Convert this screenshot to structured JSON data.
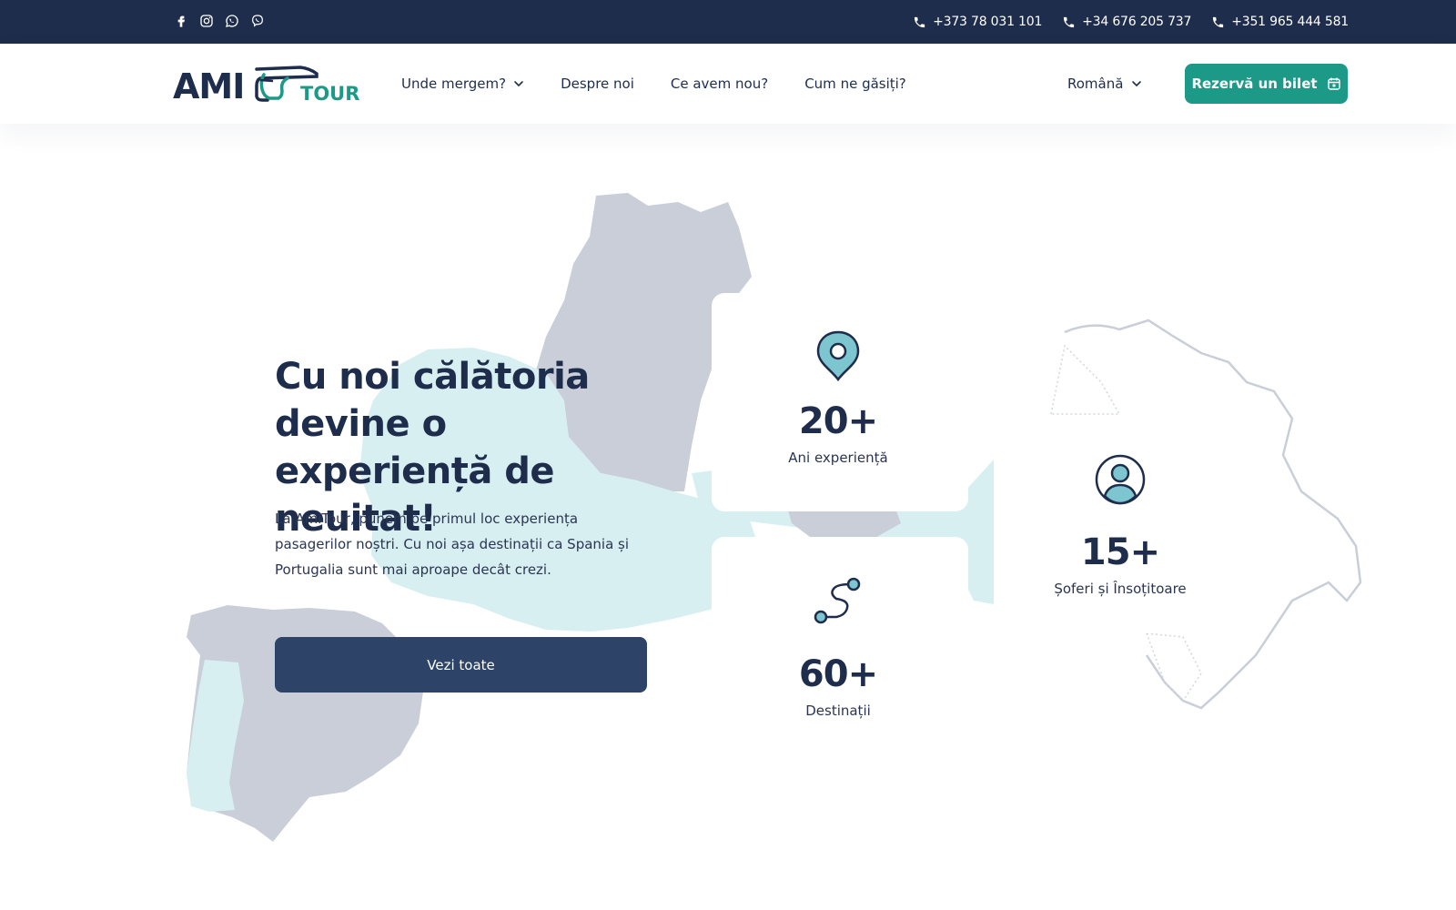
{
  "topbar": {
    "social": [
      {
        "icon": "facebook-icon"
      },
      {
        "icon": "instagram-icon"
      },
      {
        "icon": "whatsapp-icon"
      },
      {
        "icon": "viber-icon"
      }
    ],
    "phones": [
      "+373 78 031 101",
      "+34 676 205 737",
      "+351 965 444 581"
    ]
  },
  "header": {
    "logo": {
      "primary": "AMI",
      "secondary": "TOUR"
    },
    "nav": [
      "Unde mergem?",
      "Despre noi",
      "Ce avem nou?",
      "Cum ne găsiți?"
    ],
    "language": "Română",
    "book_button": "Rezervă un bilet"
  },
  "hero": {
    "title": "Cu noi călătoria devine o experiență de neuitat!",
    "text": "La AmiTour, punem pe primul loc experiența pasagerilor noștri. Cu noi așa destinații ca Spania și Portugalia sunt mai aproape decât crezi.",
    "cta": "Vezi toate"
  },
  "stats": [
    {
      "value": "20+",
      "label": "Ani experiență",
      "icon": "map-pin-icon"
    },
    {
      "value": "15+",
      "label": "Șoferi și Însoțitoare",
      "icon": "user-icon"
    },
    {
      "value": "60+",
      "label": "Destinații",
      "icon": "route-icon"
    }
  ],
  "colors": {
    "navy": "#1f2d4d",
    "teal": "#1c9a87",
    "button": "#2d4468",
    "map_gray": "#c9ced8",
    "map_light": "#d8eff2",
    "icon_teal": "#7ec6cf"
  }
}
